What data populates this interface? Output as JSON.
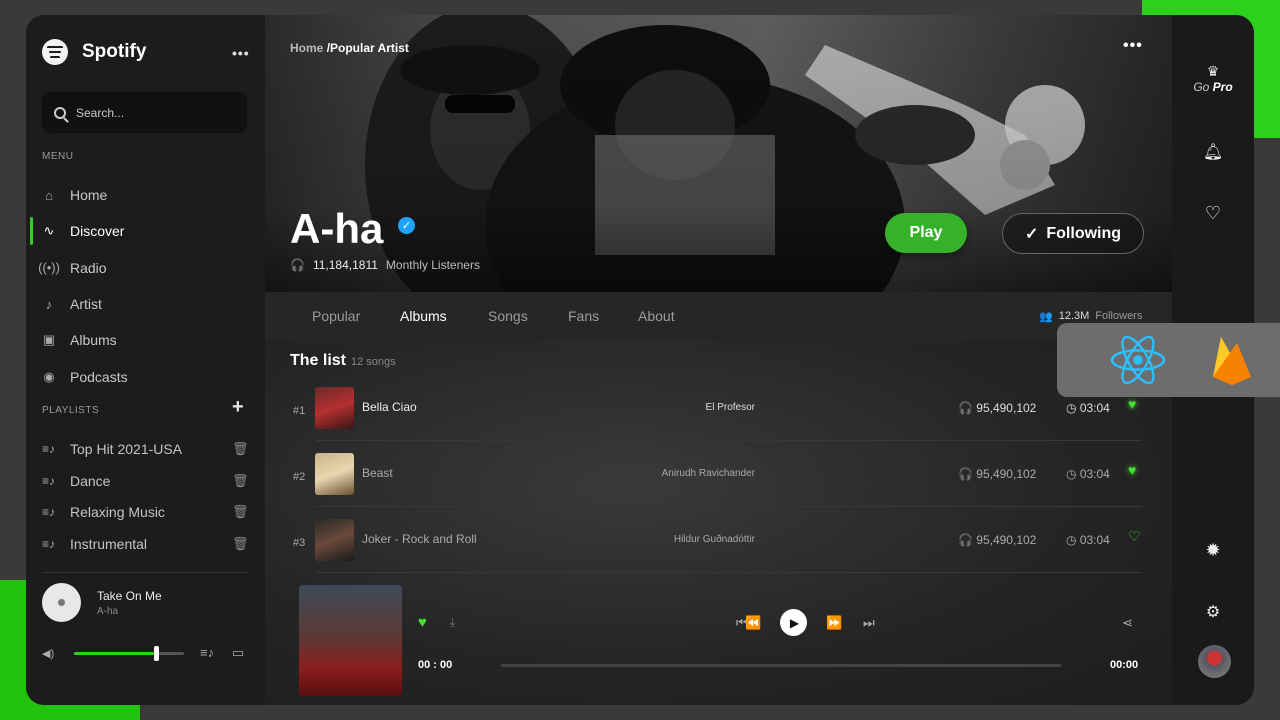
{
  "brand": {
    "name": "Spotify"
  },
  "search": {
    "placeholder": "Search..."
  },
  "sidebar": {
    "menu_label": "MENU",
    "items": [
      {
        "label": "Home",
        "icon": "home-icon"
      },
      {
        "label": "Discover",
        "icon": "pulse-icon",
        "active": true
      },
      {
        "label": "Radio",
        "icon": "radio-icon"
      },
      {
        "label": "Artist",
        "icon": "microphone-icon"
      },
      {
        "label": "Albums",
        "icon": "album-icon"
      },
      {
        "label": "Podcasts",
        "icon": "podcast-icon"
      }
    ],
    "playlists_label": "PLAYLISTS",
    "playlists": [
      {
        "label": "Top Hit 2021-USA"
      },
      {
        "label": "Dance"
      },
      {
        "label": "Relaxing Music"
      },
      {
        "label": "Instrumental"
      }
    ],
    "now_playing": {
      "title": "Take On Me",
      "artist": "A-ha"
    },
    "volume": 0.75
  },
  "hero": {
    "breadcrumb_root": "Home",
    "breadcrumb_current": "/Popular Artist",
    "artist": "A-ha",
    "listeners": "11,184,1811",
    "listeners_label": "Monthly Listeners",
    "play_label": "Play",
    "follow_label": "Following"
  },
  "tabs": {
    "items": [
      "Popular",
      "Albums",
      "Songs",
      "Fans",
      "About"
    ],
    "active": "Albums",
    "followers_count": "12.3M",
    "followers_label": "Followers"
  },
  "list": {
    "title": "The list",
    "count": "12 songs",
    "songs": [
      {
        "rank": "#1",
        "title": "Bella Ciao",
        "artist": "El Profesor",
        "plays": "95,490,102",
        "time": "03:04"
      },
      {
        "rank": "#2",
        "title": "Beast",
        "artist": "Anirudh Ravichander",
        "plays": "95,490,102",
        "time": "03:04"
      },
      {
        "rank": "#3",
        "title": "Joker - Rock and Roll",
        "artist": "Hildur Guðnadóttir",
        "plays": "95,490,102",
        "time": "03:04"
      }
    ]
  },
  "player": {
    "time_start": "00 : 00",
    "time_end": "00:00",
    "progress": 0
  },
  "rail": {
    "gopro_prefix": "Go ",
    "gopro_suffix": "Pro"
  },
  "colors": {
    "accent": "#2bd11a",
    "play_button": "#35b12a",
    "verified": "#1ea3ff"
  }
}
